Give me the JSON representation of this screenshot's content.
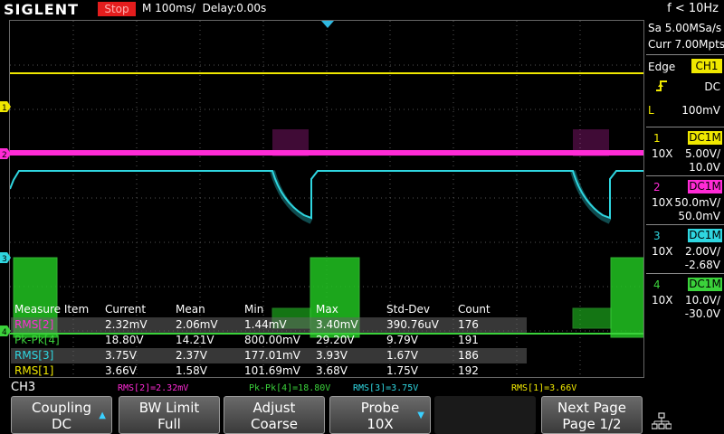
{
  "top": {
    "brand": "SIGLENT",
    "run_state": "Stop",
    "timebase": "M 100ms/  Delay:0.00s",
    "frequency": "f < 10Hz"
  },
  "acq": {
    "sample_rate": "Sa 5.00MSa/s",
    "memory": "Curr 7.00Mpts"
  },
  "trigger": {
    "type_label": "Edge",
    "source": "CH1",
    "slope_icon": "rising-edge-icon",
    "coupling": "DC",
    "level_label": "L",
    "level": "100mV"
  },
  "channels": [
    {
      "num": "1",
      "coupling": "DC1M",
      "probe": "10X",
      "scale": "5.00V/",
      "offset": "10.0V",
      "color": "#f0e800"
    },
    {
      "num": "2",
      "coupling": "DC1M",
      "probe": "10X",
      "scale": "50.0mV/",
      "offset": "50.0mV",
      "color": "#ff2bd6"
    },
    {
      "num": "3",
      "coupling": "DC1M",
      "probe": "10X",
      "scale": "2.00V/",
      "offset": "-2.68V",
      "color": "#2fd6e0"
    },
    {
      "num": "4",
      "coupling": "DC1M",
      "probe": "10X",
      "scale": "10.0V/",
      "offset": "-30.0V",
      "color": "#3bd23b"
    }
  ],
  "measure": {
    "headers": [
      "Measure Item",
      "Current",
      "Mean",
      "Min",
      "Max",
      "Std-Dev",
      "Count"
    ],
    "rows": [
      {
        "item": "RMS[2]",
        "color": "#ff2bd6",
        "current": "2.32mV",
        "mean": "2.06mV",
        "min": "1.44mV",
        "max": "3.40mV",
        "std": "390.76uV",
        "count": "176"
      },
      {
        "item": "Pk-Pk[4]",
        "color": "#3bd23b",
        "current": "18.80V",
        "mean": "14.21V",
        "min": "800.00mV",
        "max": "29.20V",
        "std": "9.79V",
        "count": "191"
      },
      {
        "item": "RMS[3]",
        "color": "#2fd6e0",
        "current": "3.75V",
        "mean": "2.37V",
        "min": "177.01mV",
        "max": "3.93V",
        "std": "1.67V",
        "count": "186"
      },
      {
        "item": "RMS[1]",
        "color": "#f0e800",
        "current": "3.66V",
        "mean": "1.58V",
        "min": "101.69mV",
        "max": "3.68V",
        "std": "1.75V",
        "count": "192"
      }
    ]
  },
  "bottom": {
    "active_channel": "CH3",
    "summary": [
      {
        "text": "RMS[2]=2.32mV",
        "color": "#ff2bd6"
      },
      {
        "text": "Pk-Pk[4]=18.80V",
        "color": "#3bd23b"
      },
      {
        "text": "RMS[3]=3.75V",
        "color": "#2fd6e0"
      },
      {
        "text": "RMS[1]=3.66V",
        "color": "#f0e800"
      }
    ]
  },
  "softkeys": [
    {
      "label": "Coupling",
      "value": "DC",
      "arrow": "up"
    },
    {
      "label": "BW Limit",
      "value": "Full",
      "arrow": ""
    },
    {
      "label": "Adjust",
      "value": "Coarse",
      "arrow": ""
    },
    {
      "label": "Probe",
      "value": "10X",
      "arrow": "down"
    },
    {
      "label": "",
      "value": "",
      "arrow": ""
    },
    {
      "label": "Next Page",
      "value": "Page 1/2",
      "arrow": ""
    }
  ],
  "network_icon": "network-icon"
}
